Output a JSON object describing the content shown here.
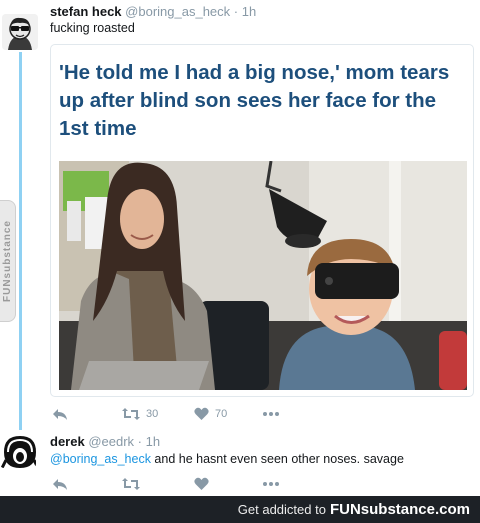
{
  "tweet1": {
    "name": "stefan heck",
    "handle": "@boring_as_heck",
    "dot": "·",
    "time": "1h",
    "text": "fucking roasted",
    "card_headline": "'He told me I had a big nose,' mom tears up after blind son sees her face for the 1st time",
    "retweets": "30",
    "likes": "70"
  },
  "tweet2": {
    "name": "derek",
    "handle": "@eedrk",
    "dot": "·",
    "time": "1h",
    "mention": "@boring_as_heck",
    "text": " and he hasnt even seen other noses. savage"
  },
  "watermark": {
    "side": "FUNsubstance"
  },
  "footer": {
    "tagline": "Get addicted to",
    "brand": "FUNsubstance.com"
  },
  "colors": {
    "link": "#1b95e0",
    "headline": "#1d4f7c",
    "thread_line": "#8fd1f3",
    "footer_bg": "#1d2126"
  },
  "icons": [
    "reply-icon",
    "retweet-icon",
    "like-icon",
    "more-icon"
  ]
}
